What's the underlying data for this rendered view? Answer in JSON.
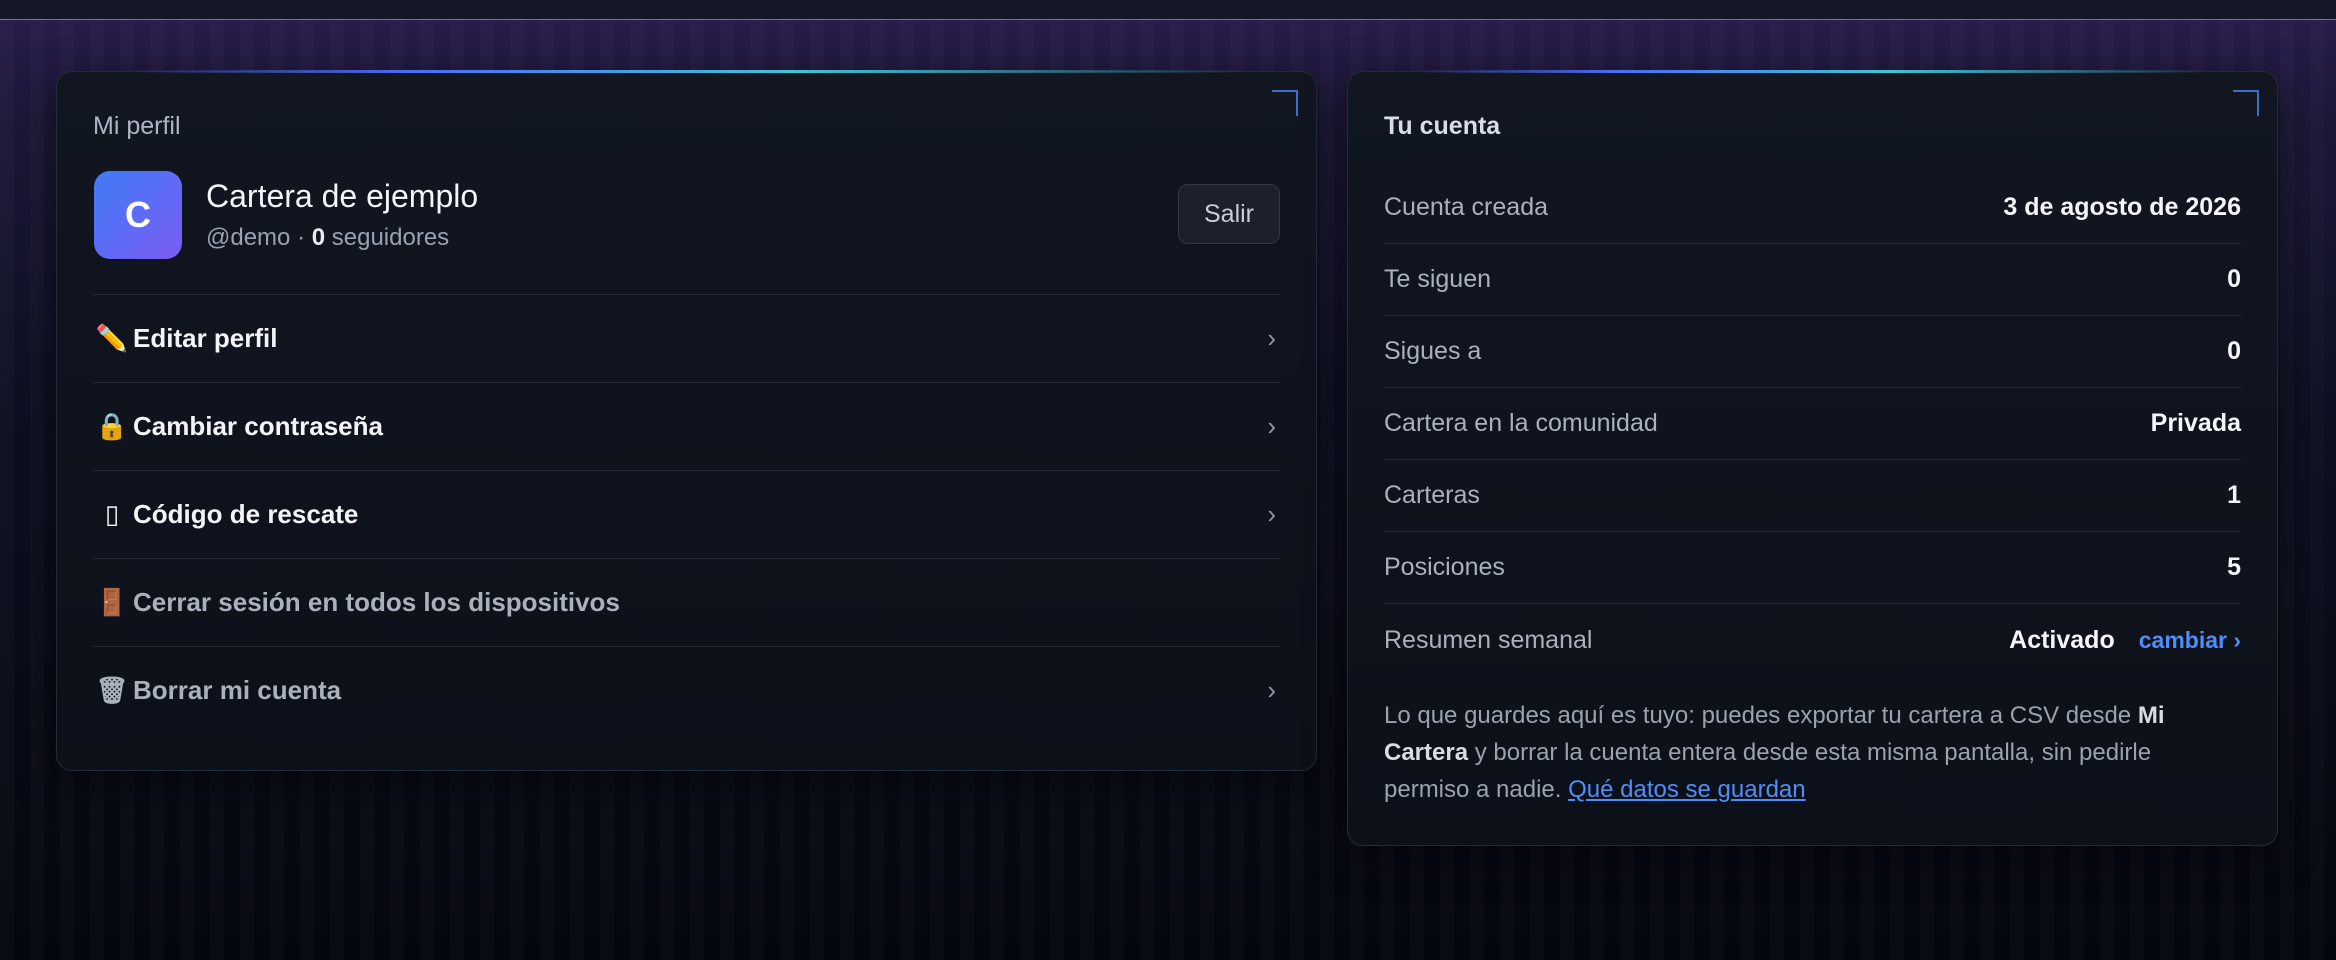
{
  "profile": {
    "title": "Mi perfil",
    "avatar_letter": "C",
    "name": "Cartera de ejemplo",
    "handle": "@demo · ",
    "followers_count": "0",
    "followers_label": " seguidores",
    "logout_label": "Salir",
    "menu": [
      {
        "icon": "pencil-icon",
        "glyph": "✏️",
        "label": "Editar perfil",
        "chevron": "›"
      },
      {
        "icon": "lock-icon",
        "glyph": "🔒",
        "label": "Cambiar contraseña",
        "chevron": "›"
      },
      {
        "icon": "key-icon",
        "glyph": "▯",
        "label": "Código de rescate",
        "chevron": "›"
      },
      {
        "icon": "door-icon",
        "glyph": "🚪",
        "label": "Cerrar sesión en todos los dispositivos",
        "chevron": ""
      },
      {
        "icon": "trash-icon",
        "glyph": "🗑",
        "label": "Borrar mi cuenta",
        "chevron": "›"
      }
    ]
  },
  "account": {
    "title": "Tu cuenta",
    "rows": [
      {
        "label": "Cuenta creada",
        "value": "3 de agosto de 2026"
      },
      {
        "label": "Te siguen",
        "value": "0"
      },
      {
        "label": "Sigues a",
        "value": "0"
      },
      {
        "label": "Cartera en la comunidad",
        "value": "Privada"
      },
      {
        "label": "Carteras",
        "value": "1"
      },
      {
        "label": "Posiciones",
        "value": "5"
      },
      {
        "label": "Resumen semanal",
        "value": "Activado",
        "link": "cambiar ›"
      }
    ],
    "note_part1": "Lo que guardes aquí es tuyo: puedes exportar tu cartera a CSV desde ",
    "note_bold": "Mi Cartera",
    "note_part2": " y borrar la cuenta entera desde esta misma pantalla, sin pedirle permiso a nadie. ",
    "note_link": "Qué datos se guardan"
  },
  "colors": {
    "accent": "#4f8ef7",
    "avatar_from": "#3f7cf6",
    "avatar_to": "#7b5bf5"
  }
}
